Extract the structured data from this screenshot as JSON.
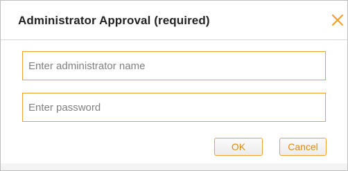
{
  "dialog": {
    "title": "Administrator Approval (required)",
    "close_icon": "close-x-icon",
    "accent_color": "#f0a030"
  },
  "form": {
    "name_placeholder": "Enter administrator name",
    "name_value": "",
    "password_placeholder": "Enter password",
    "password_value": ""
  },
  "buttons": {
    "ok_label": "OK",
    "cancel_label": "Cancel"
  }
}
